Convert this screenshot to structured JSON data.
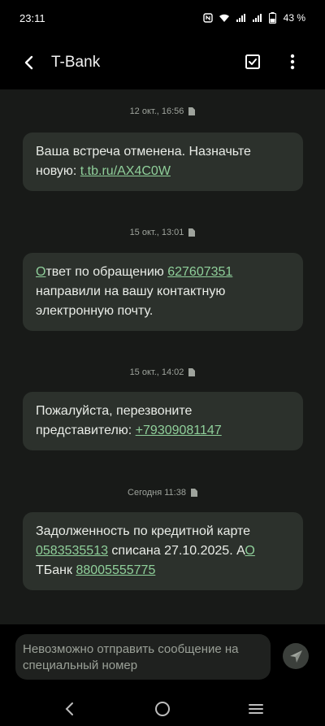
{
  "status": {
    "time": "23:11",
    "battery": "43 %"
  },
  "header": {
    "title": "T-Bank"
  },
  "messages": [
    {
      "timestamp": "12 окт., 16:56",
      "text1": "Ваша встреча отменена. Назначьте новую: ",
      "link1": "t.tb.ru/AX4C0W"
    },
    {
      "timestamp": "15 окт., 13:01",
      "link0": "О",
      "text1": "твет по обращению ",
      "link1": "627607351",
      "text2": " направили на вашу контактную электронную почту."
    },
    {
      "timestamp": "15 окт., 14:02",
      "text1": "Пожалуйста, перезвоните представителю: ",
      "link1": "+79309081147"
    },
    {
      "timestamp": "Сегодня 11:38",
      "text1": "Задолженность по кредитной карте ",
      "link1": "0583535513",
      "text2": " списана 27.10.2025. А",
      "link2": "О",
      "text3": " ТБанк ",
      "link3": "88005555775"
    }
  ],
  "composer": {
    "placeholder": "Невозможно отправить сообщение на специальный номер"
  },
  "colors": {
    "background": "#181a18",
    "bubble": "#2c312c",
    "link": "#8fcf9a",
    "bar": "#000000"
  },
  "icons": [
    "back-arrow-icon",
    "checkbox-icon",
    "more-vertical-icon",
    "send-icon",
    "nav-back-icon",
    "nav-home-icon",
    "nav-recents-icon"
  ]
}
